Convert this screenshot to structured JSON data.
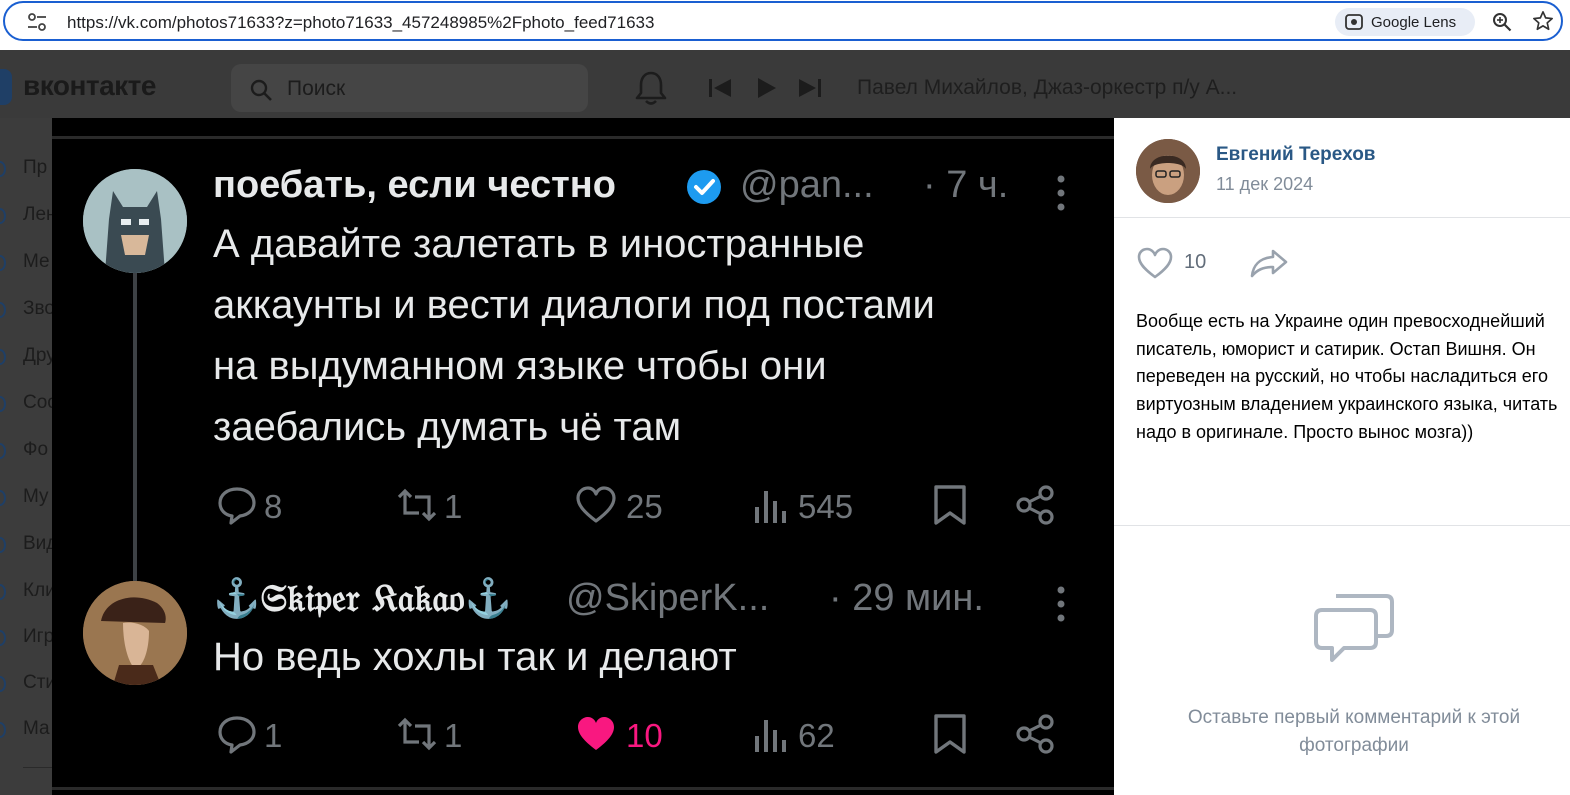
{
  "browser": {
    "url": "https://vk.com/photos71633?z=photo71633_457248985%2Fphoto_feed71633",
    "lens_label": "Google Lens"
  },
  "vk": {
    "logo_text": "вконтакте",
    "search_placeholder": "Поиск",
    "now_playing": "Павел Михайлов, Джаз-оркестр п/у А...",
    "nav_items": [
      "Пр",
      "Лен",
      "Ме",
      "Зво",
      "Дру",
      "Соо",
      "Фо",
      "Му",
      "Вид",
      "Кли",
      "Игр",
      "Сти",
      "Ма"
    ]
  },
  "tweet1": {
    "name": "поебать, если честно",
    "handle": "@pan...",
    "time": "· 7 ч.",
    "lines": [
      "А давайте залетать в иностранные",
      "аккаунты и вести диалоги под постами",
      "на выдуманном языке чтобы они",
      "заебались думать чё там"
    ],
    "replies": "8",
    "retweets": "1",
    "likes": "25",
    "views": "545"
  },
  "tweet2": {
    "name": "⚓𝔖𝔨𝔦𝔭𝔢𝔯 𝔎𝔞𝔨𝔞𝔬⚓",
    "handle": "@SkiperK...",
    "time": "· 29 мин.",
    "text": "Но ведь хохлы так и делают",
    "replies": "1",
    "retweets": "1",
    "likes": "10",
    "views": "62"
  },
  "panel": {
    "author": "Евгений Терехов",
    "date": "11 дек 2024",
    "likes": "10",
    "description": "Вообще есть на Украине один превосходнейший писатель, юморист и сатирик. Остап Вишня. Он переведен на русский, но чтобы насладиться его виртуозным владением украинского языка, читать надо в оригинале. Просто вынос мозга))",
    "empty_comments": "Оставьте первый комментарий к этой фотографии"
  },
  "colors": {
    "vk_link": "#2a5885",
    "tweet_text": "#e7e9ea",
    "tweet_muted": "#71767b",
    "like_pink": "#f91880",
    "verified_blue": "#1d9bf0"
  }
}
